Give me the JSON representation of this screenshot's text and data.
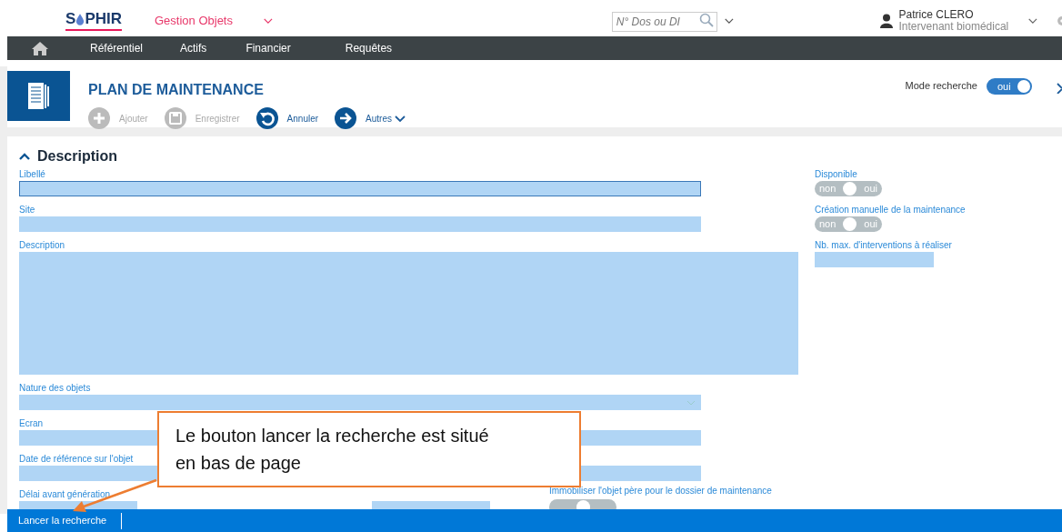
{
  "header": {
    "logo": {
      "parts": [
        "S",
        "PHIR"
      ]
    },
    "module": "Gestion Objets",
    "search": {
      "placeholder": "N° Dos ou DI"
    },
    "user": {
      "name": "Patrice CLERO",
      "role": "Intervenant biomédical"
    }
  },
  "nav": {
    "items": [
      "Référentiel",
      "Actifs",
      "Financier",
      "Requêtes"
    ]
  },
  "page": {
    "title": "PLAN DE MAINTENANCE",
    "toolbar": [
      {
        "kind": "add",
        "label": "Ajouter",
        "disabled": true,
        "dropdown": false
      },
      {
        "kind": "save",
        "label": "Enregistrer",
        "disabled": true,
        "dropdown": false
      },
      {
        "kind": "undo",
        "label": "Annuler",
        "disabled": false,
        "dropdown": false
      },
      {
        "kind": "next",
        "label": "Autres",
        "disabled": false,
        "dropdown": true
      }
    ],
    "search_mode": {
      "label": "Mode recherche",
      "on": true,
      "on_text": "oui"
    }
  },
  "section": {
    "title": "Description",
    "expanded": true,
    "left_fields": [
      {
        "label": "Libellé",
        "kind": "input",
        "focused": true
      },
      {
        "label": "Site",
        "kind": "input",
        "focused": false
      },
      {
        "label": "Description",
        "kind": "textarea",
        "focused": false
      },
      {
        "label": "Nature des objets",
        "kind": "select",
        "focused": false
      },
      {
        "label": "Ecran",
        "kind": "input",
        "focused": false
      },
      {
        "label": "Date de référence sur l'objet",
        "kind": "input",
        "focused": false
      },
      {
        "label": "Délai avant génération",
        "kind": "pair",
        "focused": false
      }
    ],
    "immobiliser": {
      "label": "Immobiliser l'objet père pour le dossier de maintenance",
      "on": false
    },
    "right_fields": [
      {
        "label": "Disponible",
        "kind": "toggle",
        "on": false,
        "off_text": "non",
        "on_text": "oui"
      },
      {
        "label": "Création manuelle de la maintenance",
        "kind": "toggle",
        "on": false,
        "off_text": "non",
        "on_text": "oui"
      },
      {
        "label": "Nb. max. d'interventions à réaliser",
        "kind": "input"
      }
    ]
  },
  "footer": {
    "button": "Lancer la recherche"
  },
  "callout": {
    "text": "Le bouton lancer la recherche est situé en bas de page"
  }
}
